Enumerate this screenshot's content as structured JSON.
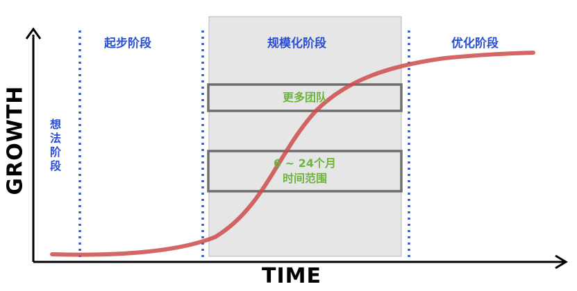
{
  "axes": {
    "y_title": "GROWTH",
    "x_title": "TIME"
  },
  "phases": {
    "idea": "想法阶段",
    "idea_chars": [
      "想",
      "法",
      "阶",
      "段"
    ],
    "startup": "起步阶段",
    "scale": "规模化阶段",
    "optimize": "优化阶段"
  },
  "callouts": {
    "teams": "更多团队",
    "timeframe_line1": "6 ~ 24个月",
    "timeframe_line2": "时间范围"
  },
  "colors": {
    "curve": "#cc4b4b",
    "divider": "#3355cc",
    "phase_text": "#2a4fd6",
    "callout_text": "#6db33f",
    "callout_border": "#6e6e6e",
    "scale_band": "#e6e6e6"
  }
}
